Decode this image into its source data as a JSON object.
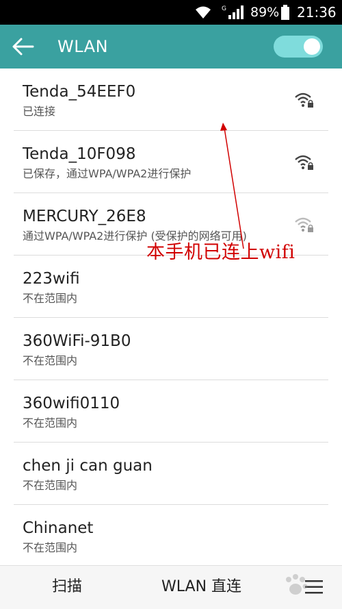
{
  "status_bar": {
    "network_type": "G",
    "battery_percent": "89%",
    "time": "21:36"
  },
  "header": {
    "title": "WLAN",
    "wlan_toggle_on": true,
    "accent_color": "#3aa1a0"
  },
  "networks": [
    {
      "name": "Tenda_54EEF0",
      "status": "已连接",
      "icon": "wifi-lock-strong-icon"
    },
    {
      "name": "Tenda_10F098",
      "status": "已保存，通过WPA/WPA2进行保护",
      "icon": "wifi-lock-strong-icon"
    },
    {
      "name": "MERCURY_26E8",
      "status": "通过WPA/WPA2进行保护 (受保护的网络可用)",
      "icon": "wifi-lock-weak-icon"
    },
    {
      "name": "223wifi",
      "status": "不在范围内"
    },
    {
      "name": "360WiFi-91B0",
      "status": "不在范围内"
    },
    {
      "name": "360wifi0110",
      "status": "不在范围内"
    },
    {
      "name": "chen ji can guan",
      "status": "不在范围内"
    },
    {
      "name": "Chinanet",
      "status": "不在范围内"
    }
  ],
  "annotation": {
    "text": "本手机已连上wifi",
    "color": "#d10000"
  },
  "bottom_bar": {
    "scan_label": "扫描",
    "direct_label": "WLAN 直连",
    "menu_icon": "menu-icon"
  }
}
